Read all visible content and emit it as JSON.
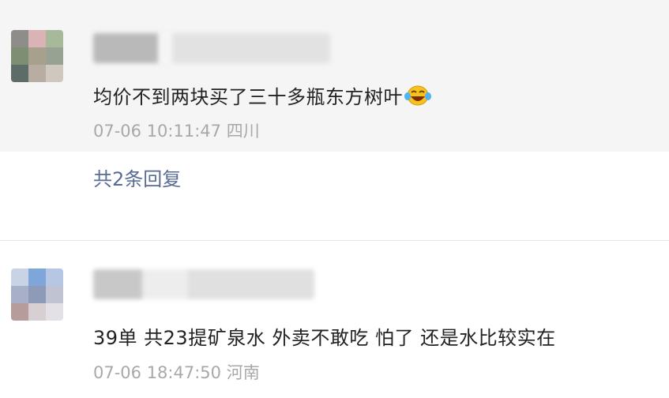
{
  "comments": [
    {
      "text": "均价不到两块买了三十多瓶东方树叶",
      "emoji": "laughing-with-tears-emoji",
      "time": "07-06 10:11:47",
      "location": "四川",
      "replies_label": "共2条回复"
    },
    {
      "text": "39单  共23提矿泉水  外卖不敢吃  怕了  还是水比较实在",
      "time": "07-06 18:47:50",
      "location": "河南"
    }
  ],
  "colors": {
    "link": "#576b95",
    "meta": "#a8a8a8",
    "highlight_bg": "#f5f5f5"
  }
}
